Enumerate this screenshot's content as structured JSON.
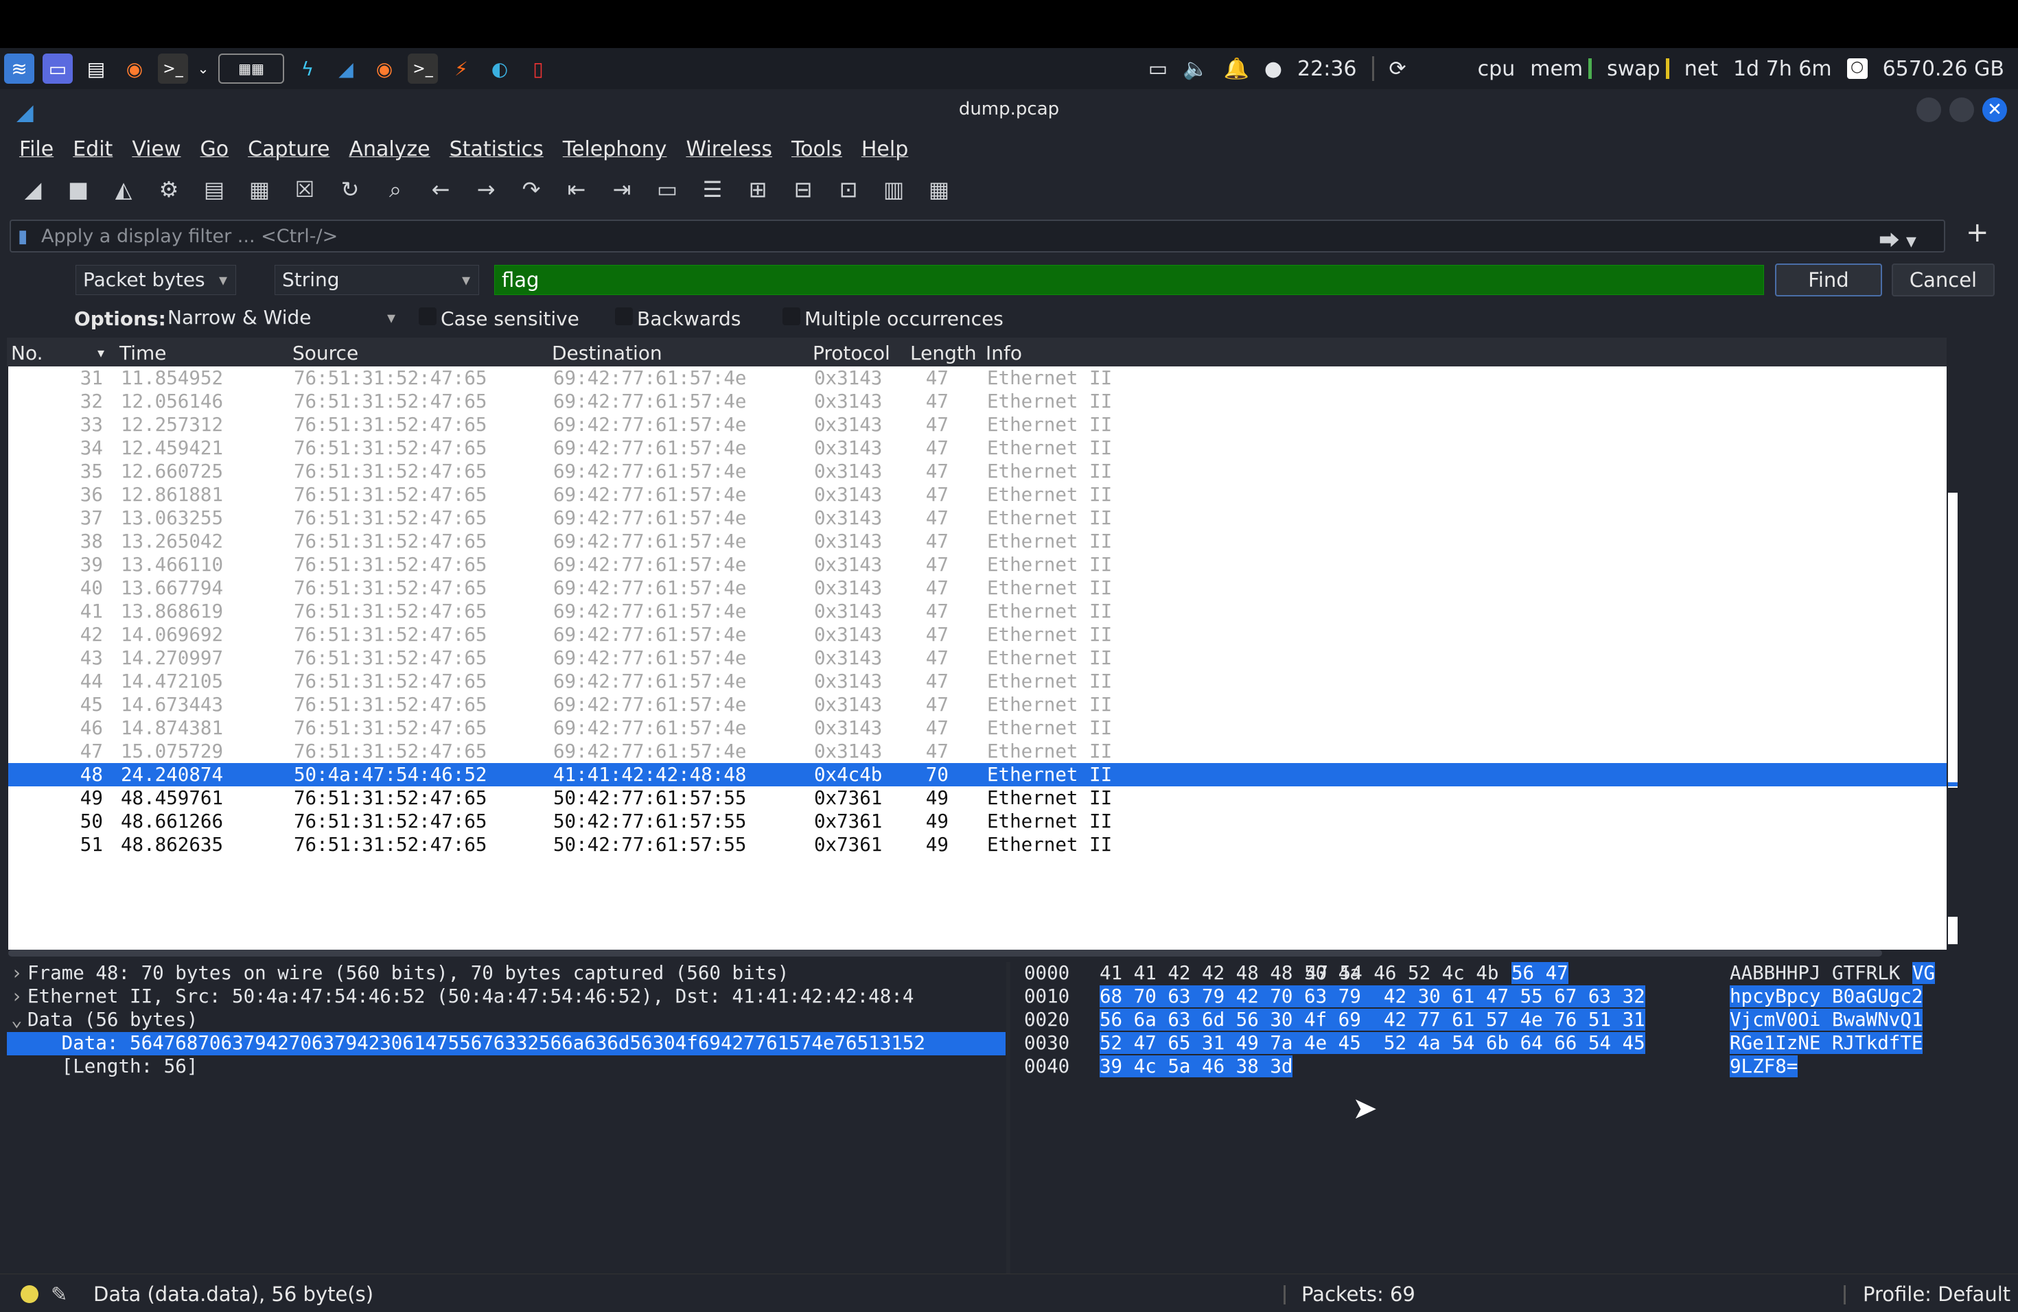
{
  "taskbar": {
    "icons": [
      "app-menu-icon",
      "desktop-icon",
      "file-manager-icon",
      "firefox-icon",
      "terminal-icon",
      "dropdown-icon",
      "workspaces-icon",
      "lightning-icon",
      "wireshark-icon",
      "firefox-icon-2",
      "terminal-icon-2",
      "burpsuite-icon",
      "edge-icon",
      "pdf-icon"
    ],
    "clock": "22:36",
    "cpu_label": "cpu",
    "mem_label": "mem",
    "swap_label": "swap",
    "net_label": "net",
    "uptime": "1d 7h 6m",
    "disk": "6570.26 GB"
  },
  "window": {
    "title": "dump.pcap"
  },
  "menu": [
    "File",
    "Edit",
    "View",
    "Go",
    "Capture",
    "Analyze",
    "Statistics",
    "Telephony",
    "Wireless",
    "Tools",
    "Help"
  ],
  "toolbar": [
    "shark-fin-start-icon",
    "stop-square-icon",
    "restart-fin-icon",
    "options-gear-icon",
    "open-file-icon",
    "save-file-icon",
    "close-file-icon",
    "reload-icon",
    "search-icon",
    "back-arrow-icon",
    "forward-arrow-icon",
    "go-to-packet-icon",
    "first-packet-icon",
    "last-packet-icon",
    "autoscroll-icon",
    "colorize-icon",
    "zoom-in-icon",
    "zoom-out-icon",
    "normal-size-icon",
    "resize-columns-icon",
    "expand-icon"
  ],
  "filter": {
    "placeholder": "Apply a display filter ... <Ctrl-/>"
  },
  "find": {
    "search_in": "Packet bytes",
    "search_type": "String",
    "value": "flag",
    "find_label": "Find",
    "cancel_label": "Cancel",
    "options_label": "Options:",
    "charset": "Narrow & Wide",
    "case_sensitive": "Case sensitive",
    "backwards": "Backwards",
    "multiple": "Multiple occurrences"
  },
  "packet_list": {
    "columns": [
      "No.",
      "Time",
      "Source",
      "Destination",
      "Protocol",
      "Length",
      "Info"
    ],
    "rows": [
      [
        "31",
        "11.854952",
        "76:51:31:52:47:65",
        "69:42:77:61:57:4e",
        "0x3143",
        "47",
        "Ethernet II"
      ],
      [
        "32",
        "12.056146",
        "76:51:31:52:47:65",
        "69:42:77:61:57:4e",
        "0x3143",
        "47",
        "Ethernet II"
      ],
      [
        "33",
        "12.257312",
        "76:51:31:52:47:65",
        "69:42:77:61:57:4e",
        "0x3143",
        "47",
        "Ethernet II"
      ],
      [
        "34",
        "12.459421",
        "76:51:31:52:47:65",
        "69:42:77:61:57:4e",
        "0x3143",
        "47",
        "Ethernet II"
      ],
      [
        "35",
        "12.660725",
        "76:51:31:52:47:65",
        "69:42:77:61:57:4e",
        "0x3143",
        "47",
        "Ethernet II"
      ],
      [
        "36",
        "12.861881",
        "76:51:31:52:47:65",
        "69:42:77:61:57:4e",
        "0x3143",
        "47",
        "Ethernet II"
      ],
      [
        "37",
        "13.063255",
        "76:51:31:52:47:65",
        "69:42:77:61:57:4e",
        "0x3143",
        "47",
        "Ethernet II"
      ],
      [
        "38",
        "13.265042",
        "76:51:31:52:47:65",
        "69:42:77:61:57:4e",
        "0x3143",
        "47",
        "Ethernet II"
      ],
      [
        "39",
        "13.466110",
        "76:51:31:52:47:65",
        "69:42:77:61:57:4e",
        "0x3143",
        "47",
        "Ethernet II"
      ],
      [
        "40",
        "13.667794",
        "76:51:31:52:47:65",
        "69:42:77:61:57:4e",
        "0x3143",
        "47",
        "Ethernet II"
      ],
      [
        "41",
        "13.868619",
        "76:51:31:52:47:65",
        "69:42:77:61:57:4e",
        "0x3143",
        "47",
        "Ethernet II"
      ],
      [
        "42",
        "14.069692",
        "76:51:31:52:47:65",
        "69:42:77:61:57:4e",
        "0x3143",
        "47",
        "Ethernet II"
      ],
      [
        "43",
        "14.270997",
        "76:51:31:52:47:65",
        "69:42:77:61:57:4e",
        "0x3143",
        "47",
        "Ethernet II"
      ],
      [
        "44",
        "14.472105",
        "76:51:31:52:47:65",
        "69:42:77:61:57:4e",
        "0x3143",
        "47",
        "Ethernet II"
      ],
      [
        "45",
        "14.673443",
        "76:51:31:52:47:65",
        "69:42:77:61:57:4e",
        "0x3143",
        "47",
        "Ethernet II"
      ],
      [
        "46",
        "14.874381",
        "76:51:31:52:47:65",
        "69:42:77:61:57:4e",
        "0x3143",
        "47",
        "Ethernet II"
      ],
      [
        "47",
        "15.075729",
        "76:51:31:52:47:65",
        "69:42:77:61:57:4e",
        "0x3143",
        "47",
        "Ethernet II"
      ],
      [
        "48",
        "24.240874",
        "50:4a:47:54:46:52",
        "41:41:42:42:48:48",
        "0x4c4b",
        "70",
        "Ethernet II"
      ],
      [
        "49",
        "48.459761",
        "76:51:31:52:47:65",
        "50:42:77:61:57:55",
        "0x7361",
        "49",
        "Ethernet II"
      ],
      [
        "50",
        "48.661266",
        "76:51:31:52:47:65",
        "50:42:77:61:57:55",
        "0x7361",
        "49",
        "Ethernet II"
      ],
      [
        "51",
        "48.862635",
        "76:51:31:52:47:65",
        "50:42:77:61:57:55",
        "0x7361",
        "49",
        "Ethernet II"
      ]
    ],
    "selected_index": 17
  },
  "details": [
    {
      "arrow": "›",
      "text": "Frame 48: 70 bytes on wire (560 bits), 70 bytes captured (560 bits)"
    },
    {
      "arrow": "›",
      "text": "Ethernet II, Src: 50:4a:47:54:46:52 (50:4a:47:54:46:52), Dst: 41:41:42:42:48:4"
    },
    {
      "arrow": "⌄",
      "text": "Data (56 bytes)"
    },
    {
      "arrow": "",
      "text": "   Data: 564768706379427063794230614755676332566a636d56304f69427761574e76513152"
    },
    {
      "arrow": "",
      "text": "   [Length: 56]"
    }
  ],
  "bytes": [
    {
      "offset": "0000",
      "hex_a": "41 41 42 42 48 48 50 4a",
      "hex_b": "47 54 46 52 4c 4b",
      "hex_b_hl": "56 47",
      "ascii_a": "AABBHHPJ GTFRLK",
      "ascii_hl": "VG"
    },
    {
      "offset": "0010",
      "hex_hl": "68 70 63 79 42 70 63 79  42 30 61 47 55 67 63 32",
      "ascii_hl": "hpcyBpcy B0aGUgc2"
    },
    {
      "offset": "0020",
      "hex_hl": "56 6a 63 6d 56 30 4f 69  42 77 61 57 4e 76 51 31",
      "ascii_hl": "VjcmV0Oi BwaWNvQ1"
    },
    {
      "offset": "0030",
      "hex_hl": "52 47 65 31 49 7a 4e 45  52 4a 54 6b 64 66 54 45",
      "ascii_hl": "RGe1IzNE RJTkdfTE"
    },
    {
      "offset": "0040",
      "hex_hl": "39 4c 5a 46 38 3d",
      "ascii_hl": "9LZF8="
    }
  ],
  "status": {
    "field": "Data (data.data), 56 byte(s)",
    "packets": "Packets: 69",
    "profile": "Profile: Default"
  }
}
